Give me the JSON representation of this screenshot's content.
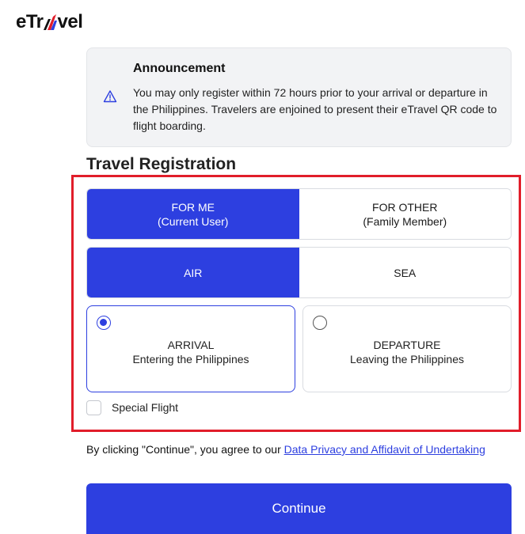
{
  "header": {
    "logo_left": "eTr",
    "logo_right": "vel"
  },
  "announcement": {
    "title": "Announcement",
    "body": "You may only register within 72 hours prior to your arrival or departure in the Philippines. Travelers are enjoined to present their eTravel QR code to flight boarding.",
    "icon": "warning-icon"
  },
  "registration": {
    "title": "Travel Registration",
    "traveler_options": [
      {
        "line1": "FOR ME",
        "line2": "(Current User)",
        "selected": true
      },
      {
        "line1": "FOR OTHER",
        "line2": "(Family Member)",
        "selected": false
      }
    ],
    "mode_options": [
      {
        "label": "AIR",
        "selected": true
      },
      {
        "label": "SEA",
        "selected": false
      }
    ],
    "direction_options": [
      {
        "line1": "ARRIVAL",
        "line2": "Entering the Philippines",
        "selected": true
      },
      {
        "line1": "DEPARTURE",
        "line2": "Leaving the Philippines",
        "selected": false
      }
    ],
    "special_flight_label": "Special Flight",
    "special_flight_checked": false
  },
  "consent": {
    "prefix": "By clicking \"Continue\", you agree to our ",
    "link_text": "Data Privacy and Affidavit of Undertaking"
  },
  "continue_label": "Continue",
  "colors": {
    "primary": "#2d3fe0",
    "highlight_border": "#e11d2a",
    "announcement_bg": "#f2f3f5",
    "logo_accent_red": "#e11d2a",
    "logo_accent_blue": "#2d3fe0"
  }
}
